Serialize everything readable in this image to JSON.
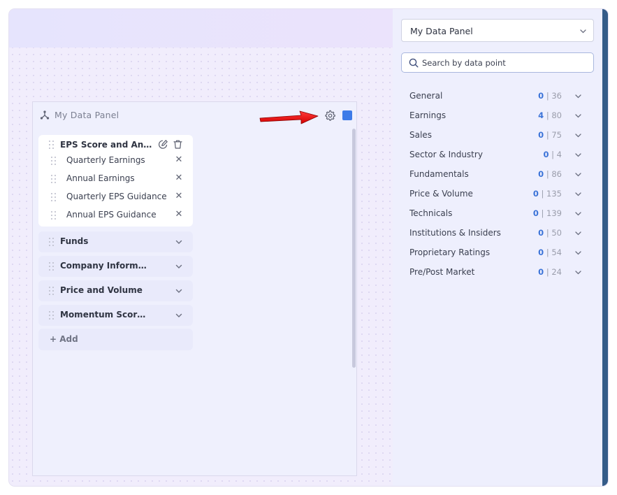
{
  "panel": {
    "title": "My Data Panel",
    "accent_color": "#3d7be8",
    "groups_open": [
      {
        "title": "EPS Score and Annual Earnings",
        "items": [
          {
            "label": "Quarterly Earnings"
          },
          {
            "label": "Annual Earnings"
          },
          {
            "label": "Quarterly EPS Guidance"
          },
          {
            "label": "Annual EPS Guidance"
          }
        ]
      }
    ],
    "groups_closed": [
      {
        "title": "Funds"
      },
      {
        "title": "Company Information"
      },
      {
        "title": "Price and Volume"
      },
      {
        "title": "Momentum Scores and Ratings"
      }
    ],
    "add_label": "+ Add"
  },
  "sidebar": {
    "select_value": "My Data Panel",
    "search_placeholder": "Search by data point",
    "categories": [
      {
        "label": "General",
        "selected": "0",
        "total": "| 36"
      },
      {
        "label": "Earnings",
        "selected": "4",
        "total": "| 80"
      },
      {
        "label": "Sales",
        "selected": "0",
        "total": "| 75"
      },
      {
        "label": "Sector & Industry",
        "selected": "0",
        "total": "| 4"
      },
      {
        "label": "Fundamentals",
        "selected": "0",
        "total": "| 86"
      },
      {
        "label": "Price & Volume",
        "selected": "0",
        "total": "| 135"
      },
      {
        "label": "Technicals",
        "selected": "0",
        "total": "| 139"
      },
      {
        "label": "Institutions & Insiders",
        "selected": "0",
        "total": "| 50"
      },
      {
        "label": "Proprietary Ratings",
        "selected": "0",
        "total": "| 54"
      },
      {
        "label": "Pre/Post Market",
        "selected": "0",
        "total": "| 24"
      }
    ]
  }
}
